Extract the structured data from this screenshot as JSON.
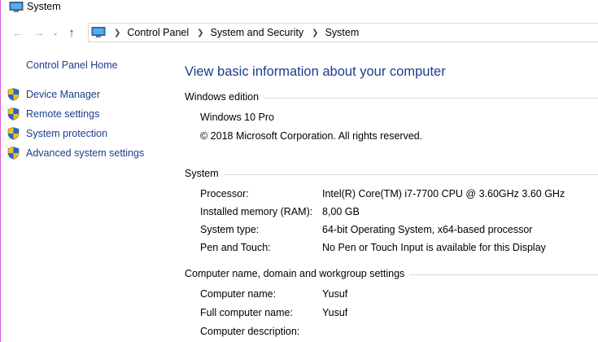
{
  "window": {
    "title": "System"
  },
  "nav": {
    "back_icon": "back-arrow-icon",
    "forward_icon": "forward-arrow-icon",
    "up_icon": "up-arrow-icon",
    "breadcrumbs": [
      "Control Panel",
      "System and Security",
      "System"
    ]
  },
  "sidebar": {
    "home": "Control Panel Home",
    "items": [
      {
        "label": "Device Manager",
        "icon": "shield-icon"
      },
      {
        "label": "Remote settings",
        "icon": "shield-icon"
      },
      {
        "label": "System protection",
        "icon": "shield-icon"
      },
      {
        "label": "Advanced system settings",
        "icon": "shield-icon"
      }
    ]
  },
  "main": {
    "title": "View basic information about your computer",
    "edition": {
      "heading": "Windows edition",
      "name": "Windows 10 Pro",
      "copyright": "© 2018 Microsoft Corporation. All rights reserved."
    },
    "system": {
      "heading": "System",
      "rows": [
        {
          "label": "Processor:",
          "value": "Intel(R) Core(TM) i7-7700 CPU @ 3.60GHz   3.60 GHz"
        },
        {
          "label": "Installed memory (RAM):",
          "value": "8,00 GB"
        },
        {
          "label": "System type:",
          "value": "64-bit Operating System, x64-based processor"
        },
        {
          "label": "Pen and Touch:",
          "value": "No Pen or Touch Input is available for this Display"
        }
      ]
    },
    "computer": {
      "heading": "Computer name, domain and workgroup settings",
      "rows": [
        {
          "label": "Computer name:",
          "value": "Yusuf"
        },
        {
          "label": "Full computer name:",
          "value": "Yusuf"
        },
        {
          "label": "Computer description:",
          "value": ""
        }
      ]
    }
  },
  "colors": {
    "link": "#1a3e8a",
    "title": "#1e3c8c",
    "divider": "#d8d8d8",
    "window_edge": "#d85cd8"
  }
}
